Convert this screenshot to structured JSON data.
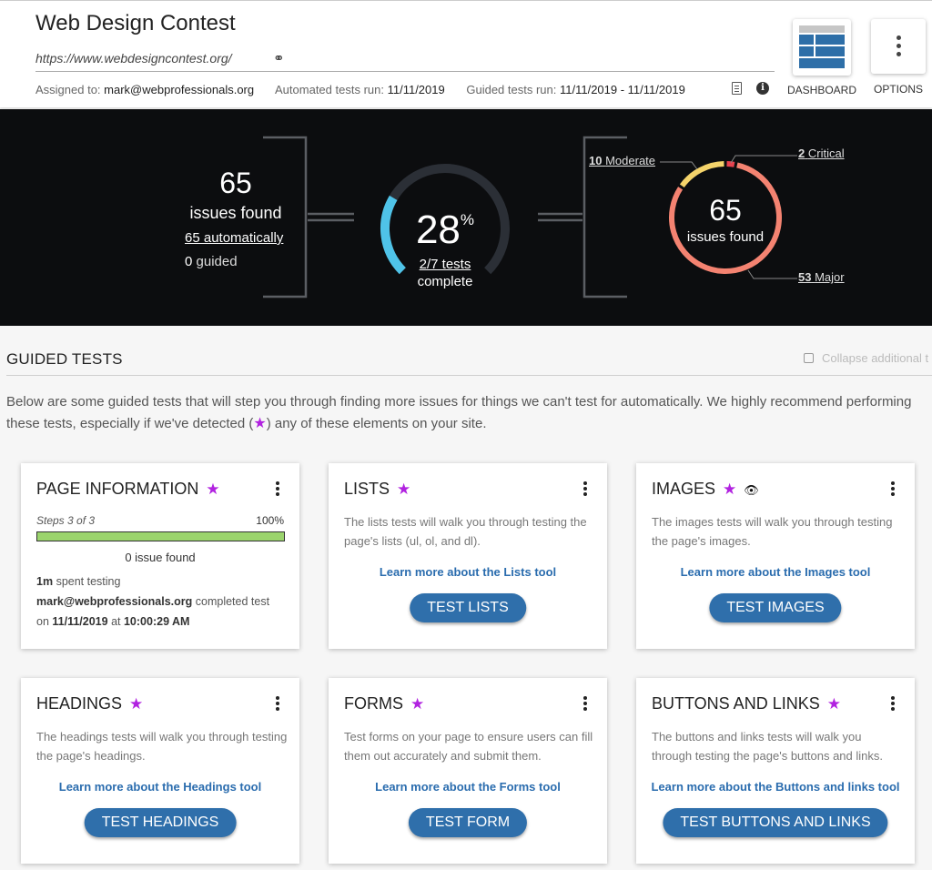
{
  "header": {
    "title": "Web Design Contest",
    "url": "https://www.webdesigncontest.org/",
    "assigned_label": "Assigned to:",
    "assigned_value": "mark@webprofessionals.org",
    "automated_label": "Automated tests run:",
    "automated_value": "11/11/2019",
    "guided_label": "Guided tests run:",
    "guided_value": "11/11/2019 - 11/11/2019",
    "dashboard_label": "DASHBOARD",
    "options_label": "OPTIONS"
  },
  "summary": {
    "issues_count": "65",
    "issues_label": "issues found",
    "automatic_link": "65 automatically",
    "guided_count": "0",
    "guided_label": "guided",
    "progress_value": "28",
    "progress_unit": "%",
    "progress_fraction": 0.28,
    "tests_link": "2/7 tests",
    "tests_label": "complete",
    "donut_count": "65",
    "donut_label": "issues found",
    "moderate_count": "10",
    "moderate_label": "Moderate",
    "critical_count": "2",
    "critical_label": "Critical",
    "major_count": "53",
    "major_label": "Major",
    "colors": {
      "progress": "#4fc3e8",
      "track": "#2b2f36",
      "moderate": "#f5d46b",
      "critical": "#e8424f",
      "major": "#f48371"
    }
  },
  "guided": {
    "heading": "GUIDED TESTS",
    "collapse_label": "Collapse additional t",
    "description_before": "Below are some guided tests that will step you through finding more issues for things we can't test for automatically. We highly recommend performing these tests, especially if we've detected (",
    "description_after": ") any of these elements on your site."
  },
  "cards": {
    "page_info": {
      "title": "PAGE INFORMATION",
      "steps": "Steps 3 of 3",
      "percent": "100%",
      "progress_fraction": 1.0,
      "issues": "0 issue found",
      "time": "1m",
      "time_label": "spent testing",
      "user": "mark@webprofessionals.org",
      "completed_label": "completed test",
      "on_label": "on",
      "date": "11/11/2019",
      "at_label": "at",
      "time_of_day": "10:00:29 AM"
    },
    "lists": {
      "title": "LISTS",
      "description": "The lists tests will walk you through testing the page's lists (ul, ol, and dl).",
      "link": "Learn more about the Lists tool",
      "button": "TEST LISTS"
    },
    "images": {
      "title": "IMAGES",
      "description": "The images tests will walk you through testing the page's images.",
      "link": "Learn more about the Images tool",
      "button": "TEST IMAGES"
    },
    "headings": {
      "title": "HEADINGS",
      "description": "The headings tests will walk you through testing the page's headings.",
      "link": "Learn more about the Headings tool",
      "button": "TEST HEADINGS"
    },
    "forms": {
      "title": "FORMS",
      "description": "Test forms on your page to ensure users can fill them out accurately and submit them.",
      "link": "Learn more about the Forms tool",
      "button": "TEST FORM"
    },
    "buttons_links": {
      "title": "BUTTONS AND LINKS",
      "description": "The buttons and links tests will walk you through testing the page's buttons and links.",
      "link": "Learn more about the Buttons and links tool",
      "button": "TEST BUTTONS AND LINKS"
    }
  },
  "icons": {
    "star": "★",
    "eye": "👁",
    "link": "🔗"
  }
}
